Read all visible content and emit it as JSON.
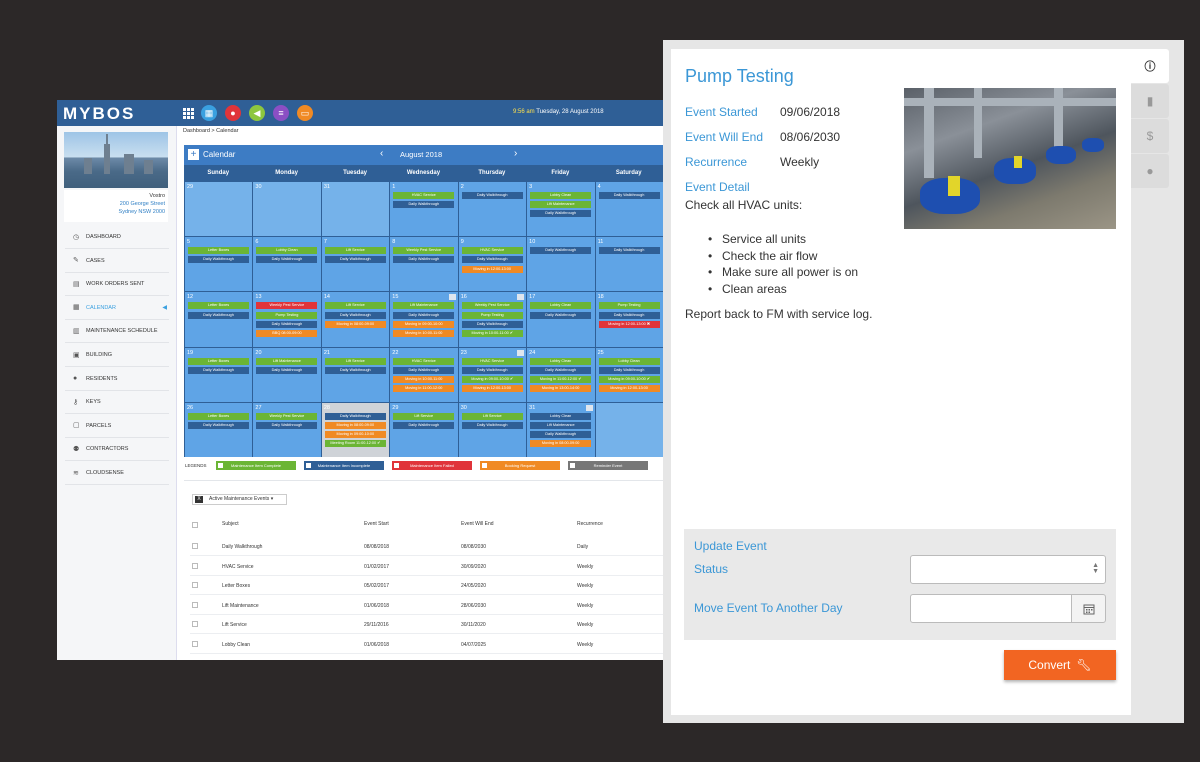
{
  "app": {
    "logo": "MYBOS",
    "time": "9:56 am",
    "date": "Tuesday, 28 August 2018"
  },
  "sidebar": {
    "building_name": "Vostro",
    "address_line1": "200 George Street",
    "address_line2": "Sydney NSW 2000",
    "items": [
      {
        "label": "DASHBOARD",
        "icon": "dashboard-icon",
        "glyph": "◷"
      },
      {
        "label": "CASES",
        "icon": "wrench-icon",
        "glyph": "✎"
      },
      {
        "label": "WORK ORDERS SENT",
        "icon": "document-icon",
        "glyph": "▤"
      },
      {
        "label": "CALENDAR",
        "icon": "calendar-icon",
        "glyph": "▦"
      },
      {
        "label": "MAINTENANCE SCHEDULE",
        "icon": "schedule-icon",
        "glyph": "▥"
      },
      {
        "label": "BUILDING",
        "icon": "building-icon",
        "glyph": "▣"
      },
      {
        "label": "RESIDENTS",
        "icon": "person-icon",
        "glyph": "●"
      },
      {
        "label": "KEYS",
        "icon": "key-icon",
        "glyph": "⚷"
      },
      {
        "label": "PARCELS",
        "icon": "parcel-icon",
        "glyph": "▢"
      },
      {
        "label": "CONTRACTORS",
        "icon": "contractors-icon",
        "glyph": "⚉"
      },
      {
        "label": "CLOUDSENSE",
        "icon": "wifi-icon",
        "glyph": "≋"
      }
    ]
  },
  "breadcrumb": "Dashboard > Calendar",
  "calendar": {
    "title": "Calendar",
    "month": "August 2018",
    "days": [
      "Sunday",
      "Monday",
      "Tuesday",
      "Wednesday",
      "Thursday",
      "Friday",
      "Saturday"
    ],
    "weeks": [
      [
        {
          "d": "29",
          "dim": true,
          "ev": []
        },
        {
          "d": "30",
          "dim": true,
          "ev": []
        },
        {
          "d": "31",
          "dim": true,
          "ev": []
        },
        {
          "d": "1",
          "ev": [
            [
              "HVAC Service",
              "g"
            ],
            [
              "Daily Walkthrough",
              "b"
            ]
          ]
        },
        {
          "d": "2",
          "ev": [
            [
              "Daily Walkthrough",
              "b"
            ]
          ]
        },
        {
          "d": "3",
          "ev": [
            [
              "Lobby Clean",
              "g"
            ],
            [
              "Lift Maintenance",
              "g"
            ],
            [
              "Daily Walkthrough",
              "b"
            ]
          ]
        },
        {
          "d": "4",
          "ev": [
            [
              "Daily Walkthrough",
              "b"
            ]
          ]
        }
      ],
      [
        {
          "d": "5",
          "ev": [
            [
              "Letter Boxes",
              "g"
            ],
            [
              "Daily Walkthrough",
              "b"
            ]
          ]
        },
        {
          "d": "6",
          "ev": [
            [
              "Lobby Clean",
              "g"
            ],
            [
              "Daily Walkthrough",
              "b"
            ]
          ]
        },
        {
          "d": "7",
          "ev": [
            [
              "Lift Service",
              "g"
            ],
            [
              "Daily Walkthrough",
              "b"
            ]
          ]
        },
        {
          "d": "8",
          "ev": [
            [
              "Weekly Pest Service",
              "g"
            ],
            [
              "Daily Walkthrough",
              "b"
            ]
          ]
        },
        {
          "d": "9",
          "ev": [
            [
              "HVAC Service",
              "g"
            ],
            [
              "Daily Walkthrough",
              "b"
            ],
            [
              "Moving in 12:00-13:00",
              "o"
            ]
          ]
        },
        {
          "d": "10",
          "ev": [
            [
              "Daily Walkthrough",
              "b"
            ]
          ]
        },
        {
          "d": "11",
          "ev": [
            [
              "Daily Walkthrough",
              "b"
            ]
          ]
        }
      ],
      [
        {
          "d": "12",
          "ev": [
            [
              "Letter Boxes",
              "g"
            ],
            [
              "Daily Walkthrough",
              "b"
            ]
          ]
        },
        {
          "d": "13",
          "ev": [
            [
              "Weekly Pest Service",
              "r"
            ],
            [
              "Pump Testing",
              "g"
            ],
            [
              "Daily Walkthrough",
              "b"
            ],
            [
              "BBQ 08:00-09:00",
              "o"
            ]
          ]
        },
        {
          "d": "14",
          "ev": [
            [
              "Lift Service",
              "g"
            ],
            [
              "Daily Walkthrough",
              "b"
            ],
            [
              "Moving in 08:00-09:00",
              "o"
            ]
          ]
        },
        {
          "d": "15",
          "grid": true,
          "ev": [
            [
              "Lift Maintenance",
              "g"
            ],
            [
              "Daily Walkthrough",
              "b"
            ],
            [
              "Moving in 09:00-10:00",
              "o"
            ],
            [
              "Moving in 10:00-11:00",
              "o"
            ]
          ]
        },
        {
          "d": "16",
          "grid": true,
          "ev": [
            [
              "Weekly Pest Service",
              "g"
            ],
            [
              "Pump Testing",
              "g"
            ],
            [
              "Daily Walkthrough",
              "b"
            ],
            [
              "Moving in 10:00-11:00 ✔",
              "g"
            ]
          ]
        },
        {
          "d": "17",
          "ev": [
            [
              "Lobby Clean",
              "g"
            ],
            [
              "Daily Walkthrough",
              "b"
            ]
          ]
        },
        {
          "d": "18",
          "ev": [
            [
              "Pump Testing",
              "g"
            ],
            [
              "Daily Walkthrough",
              "b"
            ],
            [
              "Moving in 12:00-13:00 ✖",
              "r"
            ]
          ]
        }
      ],
      [
        {
          "d": "19",
          "ev": [
            [
              "Letter Boxes",
              "g"
            ],
            [
              "Daily Walkthrough",
              "b"
            ]
          ]
        },
        {
          "d": "20",
          "ev": [
            [
              "Lift Maintenance",
              "g"
            ],
            [
              "Daily Walkthrough",
              "b"
            ]
          ]
        },
        {
          "d": "21",
          "ev": [
            [
              "Lift Service",
              "g"
            ],
            [
              "Daily Walkthrough",
              "b"
            ]
          ]
        },
        {
          "d": "22",
          "ev": [
            [
              "HVAC Service",
              "g"
            ],
            [
              "Daily Walkthrough",
              "b"
            ],
            [
              "Moving in 10:00-11:00",
              "o"
            ],
            [
              "Moving in 11:00-12:00",
              "o"
            ]
          ]
        },
        {
          "d": "23",
          "grid": true,
          "ev": [
            [
              "HVAC Service",
              "g"
            ],
            [
              "Daily Walkthrough",
              "b"
            ],
            [
              "Moving in 09:00-10:00 ✔",
              "g"
            ],
            [
              "Moving in 12:00-13:00",
              "o"
            ]
          ]
        },
        {
          "d": "24",
          "ev": [
            [
              "Lobby Clean",
              "g"
            ],
            [
              "Daily Walkthrough",
              "b"
            ],
            [
              "Moving in 11:00-12:00 ✔",
              "g"
            ],
            [
              "Moving in 13:00-14:00",
              "o"
            ]
          ]
        },
        {
          "d": "25",
          "ev": [
            [
              "Lobby Clean",
              "g"
            ],
            [
              "Daily Walkthrough",
              "b"
            ],
            [
              "Moving in 09:00-10:00 ✔",
              "g"
            ],
            [
              "Moving in 12:00-13:00",
              "o"
            ]
          ]
        }
      ],
      [
        {
          "d": "26",
          "ev": [
            [
              "Letter Boxes",
              "g"
            ],
            [
              "Daily Walkthrough",
              "b"
            ]
          ]
        },
        {
          "d": "27",
          "ev": [
            [
              "Weekly Pest Service",
              "g"
            ],
            [
              "Daily Walkthrough",
              "b"
            ]
          ]
        },
        {
          "d": "28",
          "today": true,
          "ev": [
            [
              "Daily Walkthrough",
              "b"
            ],
            [
              "Moving in 08:00-09:00",
              "o"
            ],
            [
              "Moving in 09:00-10:00",
              "o"
            ],
            [
              "Meeting Room 11:00-12:00 ✔",
              "g"
            ]
          ]
        },
        {
          "d": "29",
          "ev": [
            [
              "Lift Service",
              "g"
            ],
            [
              "Daily Walkthrough",
              "b"
            ]
          ]
        },
        {
          "d": "30",
          "ev": [
            [
              "Lift Service",
              "g"
            ],
            [
              "Daily Walkthrough",
              "b"
            ]
          ]
        },
        {
          "d": "31",
          "grid": true,
          "ev": [
            [
              "Lobby Clean",
              "b"
            ],
            [
              "Lift Maintenance",
              "b"
            ],
            [
              "Daily Walkthrough",
              "b"
            ],
            [
              "Moving in 08:00-09:00",
              "o"
            ]
          ]
        },
        {
          "d": "",
          "dim": true,
          "ev": []
        }
      ]
    ]
  },
  "legends": {
    "label": "LEGENDS",
    "items": [
      {
        "label": "Maintenance Item Complete",
        "color": "#6bb535"
      },
      {
        "label": "Maintenance Item Incomplete",
        "color": "#2f5f96"
      },
      {
        "label": "Maintenance Item Failed",
        "color": "#e0343a"
      },
      {
        "label": "Booking Request",
        "color": "#f08a24"
      },
      {
        "label": "Reminder Event",
        "color": "#777777"
      }
    ]
  },
  "table": {
    "filter": "Active Maintenance Events ▾",
    "headers": [
      "Subject",
      "Event Start",
      "Event Will End",
      "Recurrence"
    ],
    "rows": [
      [
        "Daily Walkthrough",
        "08/08/2018",
        "08/08/2030",
        "Daily"
      ],
      [
        "HVAC Service",
        "01/02/2017",
        "30/09/2020",
        "Weekly"
      ],
      [
        "Letter Boxes",
        "05/02/2017",
        "24/05/2020",
        "Weekly"
      ],
      [
        "Lift Maintenance",
        "01/06/2018",
        "28/06/2030",
        "Weekly"
      ],
      [
        "Lift Service",
        "29/11/2016",
        "30/11/2020",
        "Weekly"
      ],
      [
        "Lobby Clean",
        "01/06/2018",
        "04/07/2025",
        "Weekly"
      ]
    ]
  },
  "modal": {
    "title": "Pump Testing",
    "fields": [
      {
        "label": "Event Started",
        "value": "09/06/2018"
      },
      {
        "label": "Event Will End",
        "value": "08/06/2030"
      },
      {
        "label": "Recurrence",
        "value": "Weekly"
      },
      {
        "label": "Event Detail",
        "value": ""
      }
    ],
    "description": "Check all HVAC units:",
    "checklist": [
      "Service all units",
      "Check the air flow",
      "Make sure all power is on",
      "Clean areas"
    ],
    "report": "Report back to FM with service log.",
    "update": {
      "title": "Update Event",
      "status_label": "Status",
      "status_value": "",
      "move_label": "Move Event To Another Day",
      "move_value": ""
    },
    "convert_label": "Convert",
    "tabs": [
      "info-icon",
      "document-icon",
      "dollar-icon",
      "comment-icon"
    ]
  }
}
